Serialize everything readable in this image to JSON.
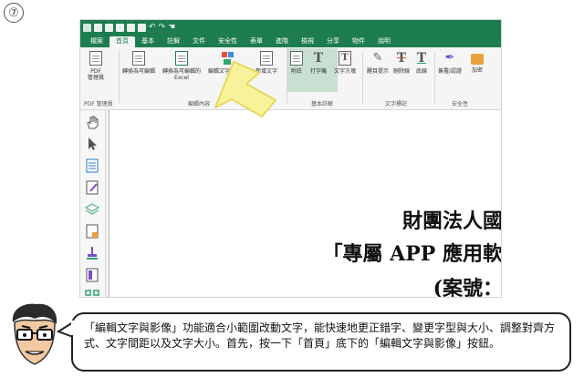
{
  "step": {
    "number": "⑦"
  },
  "app": {
    "menu_tabs": [
      "檔案",
      "首頁",
      "基本",
      "註解",
      "文件",
      "安全性",
      "表單",
      "進階",
      "檢視",
      "分享",
      "物件",
      "說明"
    ],
    "active_tab": "首頁",
    "ribbon": {
      "pdf_manager": {
        "line1": "PDF",
        "line2": "管理員"
      },
      "group_pdf_manager": "PDF 管理員",
      "convert_editable": "轉換為可編輯",
      "convert_excel": {
        "line1": "轉換為可編輯的",
        "line2": "Excel"
      },
      "edit_text_image": "編輯文字與影像",
      "add_text": "新增文字",
      "group_edit_content": "編輯內容",
      "note": "附註",
      "typewriter": "打字機",
      "textbox": "文字方塊",
      "group_basic_notes": "基本註解",
      "highlight": "醒目提示",
      "strikethrough": "刪除線",
      "underline": "底線",
      "group_text_markup": "文字標記",
      "sign": "簽署/認證",
      "encrypt": "加密",
      "group_security": "安全性"
    },
    "document": {
      "line1": "財團法人國",
      "line2": "「專屬 APP 應用軟",
      "line3": "(案號："
    }
  },
  "caption": {
    "text": "「編輯文字與影像」功能適合小範圍改動文字，能快速地更正錯字、變更字型與大小、調整對齊方式、文字間距以及文字大小。首先，按一下「首頁」底下的「編輯文字與影像」按鈕。"
  },
  "colors": {
    "brand_green": "#1e7d4f",
    "arrow_yellow": "#f8f29a"
  }
}
